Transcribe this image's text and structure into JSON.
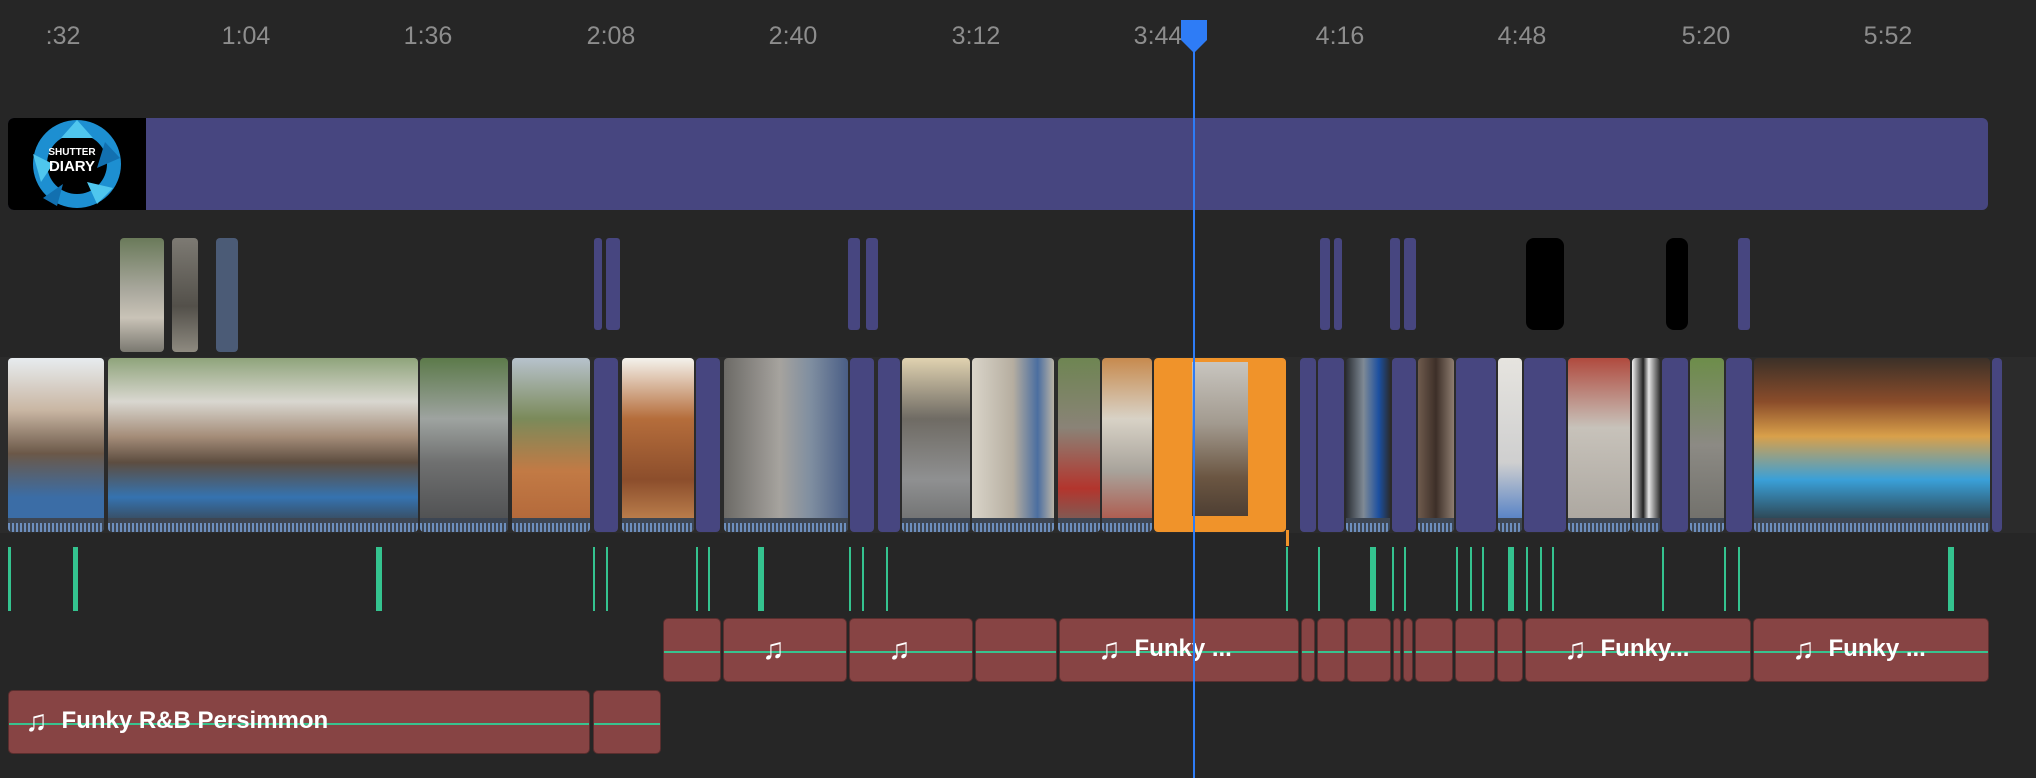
{
  "ruler": {
    "ticks": [
      ":32",
      "1:04",
      "1:36",
      "2:08",
      "2:40",
      "3:12",
      "3:44",
      "4:16",
      "4:48",
      "5:20",
      "5:52"
    ]
  },
  "playhead": {
    "time": "3:50"
  },
  "title_track": {
    "logo": {
      "line1": "SHUTTER",
      "line2": "DIARY"
    },
    "color": "#474680"
  },
  "colors": {
    "background": "#262626",
    "title_clip": "#474680",
    "selected_clip": "#f0932a",
    "music_clip": "#874444",
    "marker": "#34c38f",
    "playhead": "#2e7cf6"
  },
  "music_track_1": {
    "clips": [
      {
        "label": ""
      },
      {
        "label": ""
      },
      {
        "label": ""
      },
      {
        "label": ""
      },
      {
        "label": "Funky ..."
      },
      {
        "label": ""
      },
      {
        "label": ""
      },
      {
        "label": ""
      },
      {
        "label": ""
      },
      {
        "label": ""
      },
      {
        "label": ""
      },
      {
        "label": ""
      },
      {
        "label": ""
      },
      {
        "label": "Funky..."
      },
      {
        "label": "Funky ..."
      }
    ]
  },
  "music_track_2": {
    "clips": [
      {
        "label": "Funky R&B Persimmon"
      },
      {
        "label": ""
      }
    ]
  }
}
